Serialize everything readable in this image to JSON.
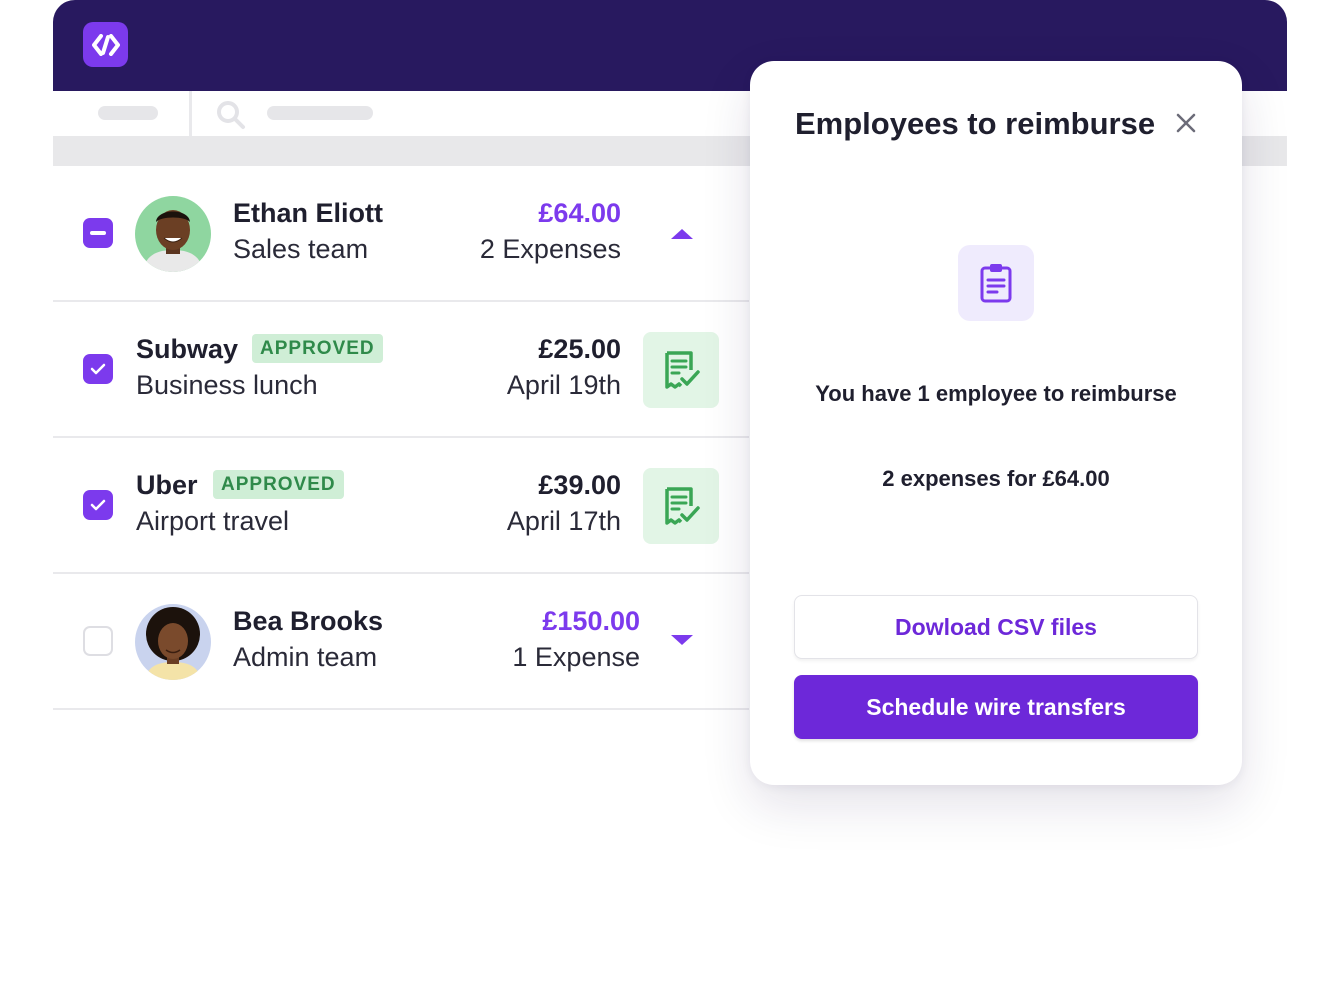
{
  "app": {
    "brand_color": "#28195f",
    "accent": "#7c3aed",
    "logo_icon": "swap-arrows-icon"
  },
  "rows": [
    {
      "type": "employee",
      "name": "Ethan Eliott",
      "team": "Sales team",
      "amount": "£64.00",
      "detail": "2 Expenses",
      "checkbox": "indeterminate",
      "expanded": true
    },
    {
      "type": "expense",
      "merchant": "Subway",
      "status": "APPROVED",
      "purpose": "Business lunch",
      "amount": "£25.00",
      "date": "April 19th",
      "checked": true,
      "icon": "receipt-check-icon"
    },
    {
      "type": "expense",
      "merchant": "Uber",
      "status": "APPROVED",
      "purpose": "Airport travel",
      "amount": "£39.00",
      "date": "April 17th",
      "checked": true,
      "icon": "receipt-check-icon"
    },
    {
      "type": "employee",
      "name": "Bea Brooks",
      "team": "Admin team",
      "amount": "£150.00",
      "detail": "1 Expense",
      "checkbox": "unchecked",
      "expanded": false
    }
  ],
  "panel": {
    "title": "Employees to reimburse",
    "icon": "clipboard-icon",
    "message": "You have 1 employee to reimburse",
    "summary": "2 expenses for £64.00",
    "download_label": "Dowload CSV files",
    "schedule_label": "Schedule wire transfers"
  }
}
